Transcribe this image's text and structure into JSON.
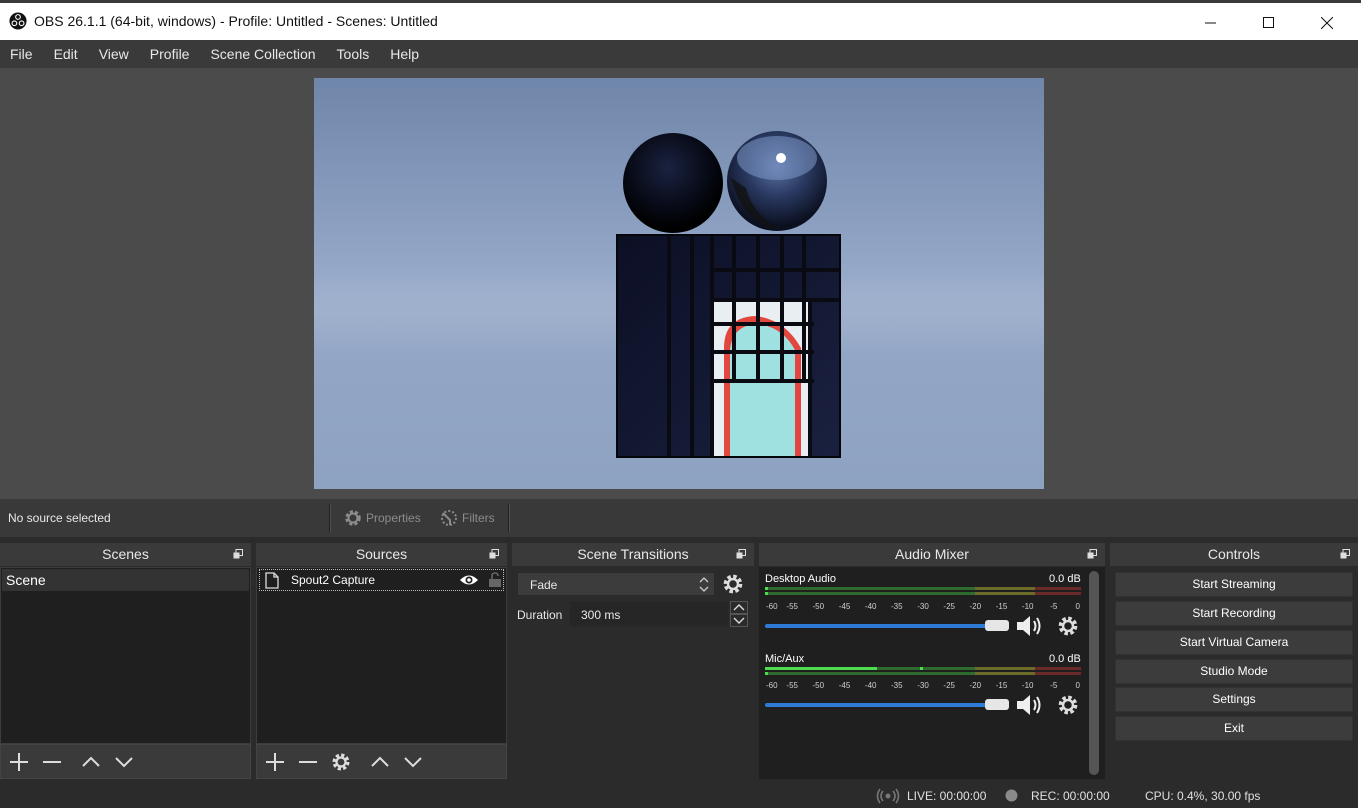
{
  "window": {
    "title": "OBS 26.1.1 (64-bit, windows) - Profile: Untitled - Scenes: Untitled"
  },
  "menu": [
    "File",
    "Edit",
    "View",
    "Profile",
    "Scene Collection",
    "Tools",
    "Help"
  ],
  "source_toolbar": {
    "status": "No source selected",
    "properties_label": "Properties",
    "filters_label": "Filters"
  },
  "scenes": {
    "title": "Scenes",
    "items": [
      "Scene"
    ]
  },
  "sources": {
    "title": "Sources",
    "items": [
      {
        "name": "Spout2 Capture",
        "visible": true,
        "locked": false
      }
    ]
  },
  "transitions": {
    "title": "Scene Transitions",
    "selected": "Fade",
    "duration_label": "Duration",
    "duration_value": "300 ms"
  },
  "mixer": {
    "title": "Audio Mixer",
    "channels": [
      {
        "name": "Desktop Audio",
        "db": "0.0 dB",
        "volume": 1.0
      },
      {
        "name": "Mic/Aux",
        "db": "0.0 dB",
        "volume": 1.0
      }
    ],
    "scale": [
      "-60",
      "-55",
      "-50",
      "-45",
      "-40",
      "-35",
      "-30",
      "-25",
      "-20",
      "-15",
      "-10",
      "-5",
      "0"
    ]
  },
  "controls": {
    "title": "Controls",
    "start_streaming": "Start Streaming",
    "start_recording": "Start Recording",
    "start_virtual_camera": "Start Virtual Camera",
    "studio_mode": "Studio Mode",
    "settings": "Settings",
    "exit": "Exit"
  },
  "status": {
    "live": "LIVE: 00:00:00",
    "rec": "REC: 00:00:00",
    "cpu": "CPU: 0.4%, 30.00 fps"
  },
  "colors": {
    "accent_blue": "#2d7bd6",
    "panel": "#2b2b2b",
    "header": "#3a3a3a"
  }
}
